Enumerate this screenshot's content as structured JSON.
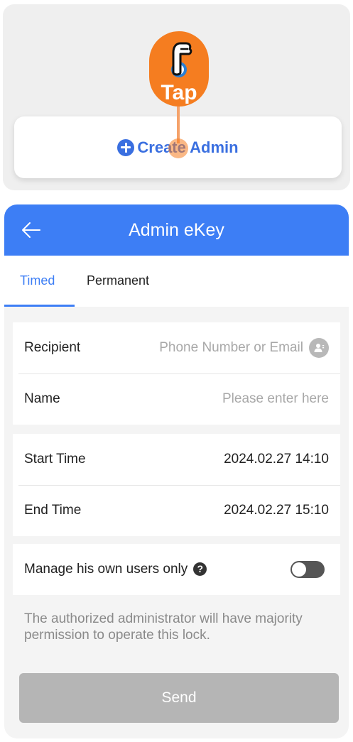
{
  "create_card": {
    "label": "Create Admin"
  },
  "tap_hint": {
    "label": "Tap"
  },
  "nav": {
    "title": "Admin eKey"
  },
  "tabs": [
    {
      "label": "Timed",
      "active": true
    },
    {
      "label": "Permanent",
      "active": false
    }
  ],
  "form": {
    "recipient": {
      "label": "Recipient",
      "placeholder": "Phone Number or Email"
    },
    "name": {
      "label": "Name",
      "placeholder": "Please enter here"
    },
    "start_time": {
      "label": "Start Time",
      "value": "2024.02.27 14:10"
    },
    "end_time": {
      "label": "End Time",
      "value": "2024.02.27 15:10"
    },
    "manage_own": {
      "label": "Manage his own users only",
      "help_glyph": "?",
      "enabled": false
    }
  },
  "hint": "The authorized administrator will have majority permission to operate this lock.",
  "send_label": "Send",
  "colors": {
    "primary": "#3d7ef5",
    "tap_orange": "#f57d20",
    "disabled_button": "#b5b5b5"
  }
}
